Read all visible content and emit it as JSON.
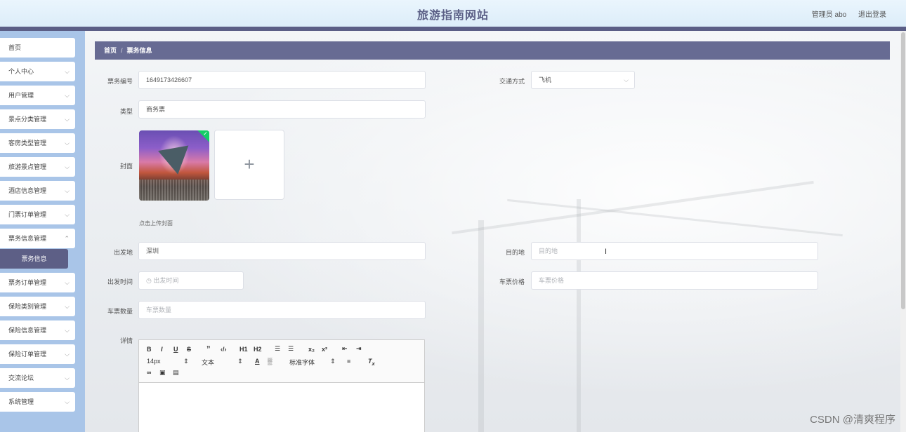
{
  "header": {
    "title": "旅游指南网站",
    "user": "管理员 abo",
    "logout": "退出登录"
  },
  "sidebar": {
    "items": [
      {
        "label": "首页",
        "chevron": false
      },
      {
        "label": "个人中心",
        "chevron": true
      },
      {
        "label": "用户管理",
        "chevron": true
      },
      {
        "label": "景点分类管理",
        "chevron": true
      },
      {
        "label": "客房类型管理",
        "chevron": true
      },
      {
        "label": "旅游景点管理",
        "chevron": true
      },
      {
        "label": "酒店信息管理",
        "chevron": true
      },
      {
        "label": "门票订单管理",
        "chevron": true
      },
      {
        "label": "票务信息管理",
        "chevron": true
      }
    ],
    "active_sub": "票务信息",
    "items_after": [
      {
        "label": "票务订单管理"
      },
      {
        "label": "保险类别管理"
      },
      {
        "label": "保险信息管理"
      },
      {
        "label": "保险订单管理"
      },
      {
        "label": "交流论坛"
      },
      {
        "label": "系统管理"
      }
    ]
  },
  "breadcrumb": {
    "home": "首页",
    "separator": "/",
    "current": "票务信息"
  },
  "form": {
    "ticket_no_label": "票务编号",
    "ticket_no_value": "1649173426607",
    "transport_label": "交通方式",
    "transport_value": "飞机",
    "type_label": "类型",
    "type_value": "商务票",
    "cover_label": "封面",
    "upload_plus": "+",
    "upload_tip": "点击上传封面",
    "departure_label": "出发地",
    "departure_value": "深圳",
    "destination_label": "目的地",
    "destination_placeholder": "目的地",
    "depart_time_label": "出发时间",
    "depart_time_placeholder": "出发时间",
    "price_label": "车票价格",
    "price_placeholder": "车票价格",
    "quantity_label": "车票数量",
    "quantity_placeholder": "车票数量",
    "detail_label": "详情"
  },
  "editor": {
    "font_size": "14px",
    "text_type": "文本",
    "font_family": "标准字体"
  },
  "watermark": "CSDN @清爽程序"
}
